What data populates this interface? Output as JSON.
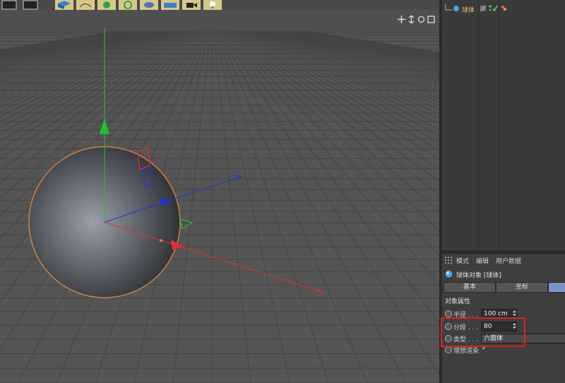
{
  "object_manager": {
    "object_name": "球体"
  },
  "attributes": {
    "menu": [
      "模式",
      "编辑",
      "用户数据"
    ],
    "object_title": "球体对象 [球体]",
    "tabs": [
      "基本",
      "坐标"
    ],
    "section_title": "对象属性",
    "props": [
      {
        "label": "半径 . . .",
        "value": "100 cm"
      },
      {
        "label": "分段 . . .",
        "value": "80"
      },
      {
        "label": "类型 . . .",
        "value": "六面体"
      },
      {
        "label": "理想渲染",
        "value": "✓"
      }
    ]
  },
  "colors": {
    "accent": "#e8c060",
    "highlight": "#e02020",
    "axis_x": "#e03030",
    "axis_y": "#20c030",
    "axis_z": "#2030e0",
    "selection": "#d08040"
  }
}
